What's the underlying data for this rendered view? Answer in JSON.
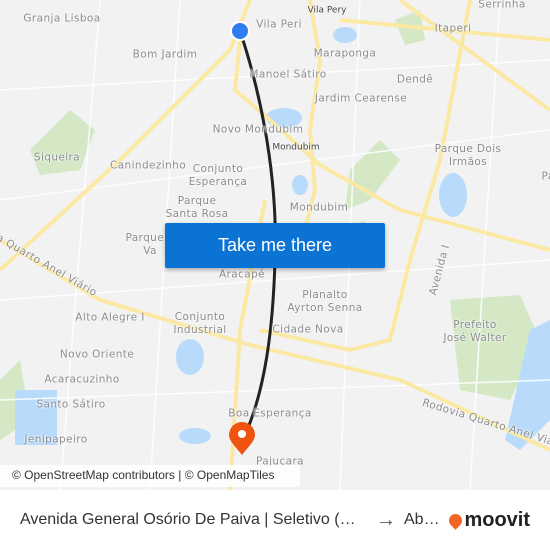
{
  "map": {
    "labels": [
      "Granja Lisboa",
      "Vila Peri",
      "Vila Pery",
      "Serrinha",
      "Itaperi",
      "Bom Jardim",
      "Maraponga",
      "Manoel Sátiro",
      "Dendê",
      "Jardim Cearense",
      "Novo Mondubim",
      "Mondubim",
      "Siqueira",
      "Canindezinho",
      "Conjunto\nEsperança",
      "Parque Dois\nIrmãos",
      "Pa",
      "Parque\nSanta Rosa",
      "Mondubim",
      "Parque P\nVa",
      "Aracapé",
      "Planalto\nAyrton Senna",
      "Avenida I",
      "Alto Alegre I",
      "Conjunto\nIndustrial",
      "Cidade Nova",
      "Prefeito\nJosé Walter",
      "Novo Oriente",
      "Acaracuzinho",
      "Santo Sátiro",
      "Boa Esperança",
      "Jenipapeiro",
      "Pajuçara",
      "Rodovia Quarto Anel Viário",
      "ia Quarto Anel Viário"
    ],
    "origin_color": "#2d7cf0",
    "destination_color": "#f0520f",
    "route_color": "#222222"
  },
  "cta": {
    "label": "Take me there"
  },
  "attribution": "© OpenStreetMap contributors | © OpenMapTiles",
  "footer": {
    "from": "Avenida General Osório De Paiva | Seletivo (…",
    "arrow_icon": "arrow-right-icon",
    "to": "Ab…",
    "brand": "moovit",
    "brand_color": "#f26522"
  }
}
